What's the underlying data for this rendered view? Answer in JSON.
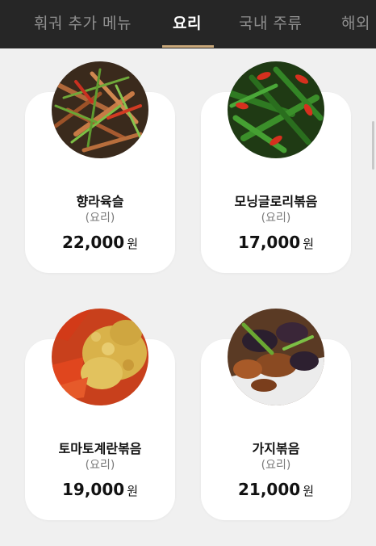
{
  "tabs": [
    {
      "label": "훠궈 추가 메뉴",
      "active": false
    },
    {
      "label": "요리",
      "active": true
    },
    {
      "label": "국내 주류",
      "active": false
    },
    {
      "label": "해외",
      "active": false
    }
  ],
  "colors": {
    "tab_bar_bg": "#262626",
    "active_underline": "#c9a87a",
    "page_bg": "#f0f0f0",
    "card_bg": "#ffffff"
  },
  "menu": {
    "items": [
      {
        "name": "향라육슬",
        "category": "(요리)",
        "price": "22,000",
        "currency": "원",
        "image": "shredded-pork-photo"
      },
      {
        "name": "모닝글로리볶음",
        "category": "(요리)",
        "price": "17,000",
        "currency": "원",
        "image": "morning-glory-photo"
      },
      {
        "name": "토마토계란볶음",
        "category": "(요리)",
        "price": "19,000",
        "currency": "원",
        "image": "tomato-egg-photo"
      },
      {
        "name": "가지볶음",
        "category": "(요리)",
        "price": "21,000",
        "currency": "원",
        "image": "eggplant-photo"
      }
    ]
  }
}
